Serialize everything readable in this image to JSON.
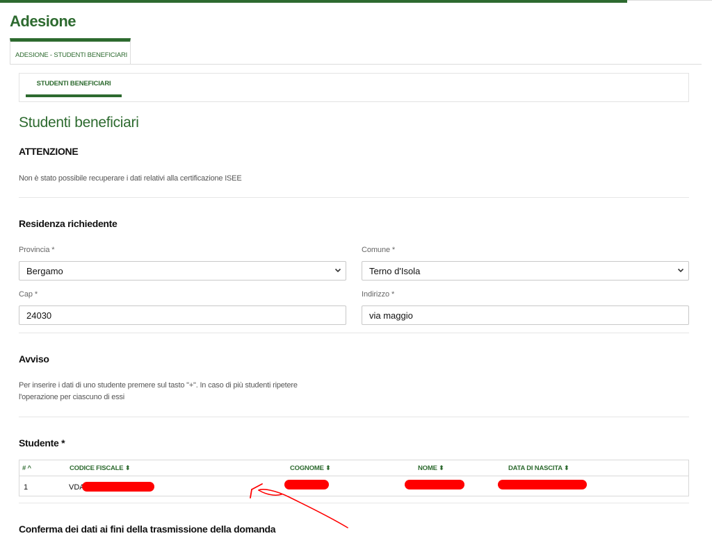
{
  "page": {
    "title": "Adesione"
  },
  "tabs": {
    "main_tab": "ADESIONE - STUDENTI BENEFICIARI"
  },
  "subtabs": {
    "active": "STUDENTI BENEFICIARI"
  },
  "section": {
    "title": "Studenti beneficiari"
  },
  "attention": {
    "heading": "ATTENZIONE",
    "text": "Non è stato possibile recuperare i dati relativi alla certificazione ISEE"
  },
  "residence": {
    "heading": "Residenza richiedente",
    "provincia_label": "Provincia *",
    "provincia_value": "Bergamo",
    "comune_label": "Comune *",
    "comune_value": "Terno d'Isola",
    "cap_label": "Cap *",
    "cap_value": "24030",
    "indirizzo_label": "Indirizzo *",
    "indirizzo_value": "via maggio"
  },
  "notice": {
    "heading": "Avviso",
    "line1": "Per inserire i dati di uno studente premere sul tasto \"+\". In caso di più studenti ripetere",
    "line2": "l'operazione per ciascuno di essi"
  },
  "students": {
    "heading": "Studente *",
    "columns": {
      "index": "# ^",
      "codice_fiscale": "CODICE FISCALE ⬍",
      "cognome": "COGNOME ⬍",
      "nome": "NOME ⬍",
      "data_nascita": "DATA DI NASCITA ⬍"
    },
    "rows": [
      {
        "index": "1",
        "codice_fiscale": "VDA"
      }
    ]
  },
  "confirm": {
    "heading": "Conferma dei dati ai fini della trasmissione della domanda"
  },
  "icons": {
    "select_chevron": "chevron-down-icon",
    "annotation": "red-arrow-icon"
  },
  "colors": {
    "brand": "#2d6a2f",
    "redaction": "#ff0000"
  }
}
